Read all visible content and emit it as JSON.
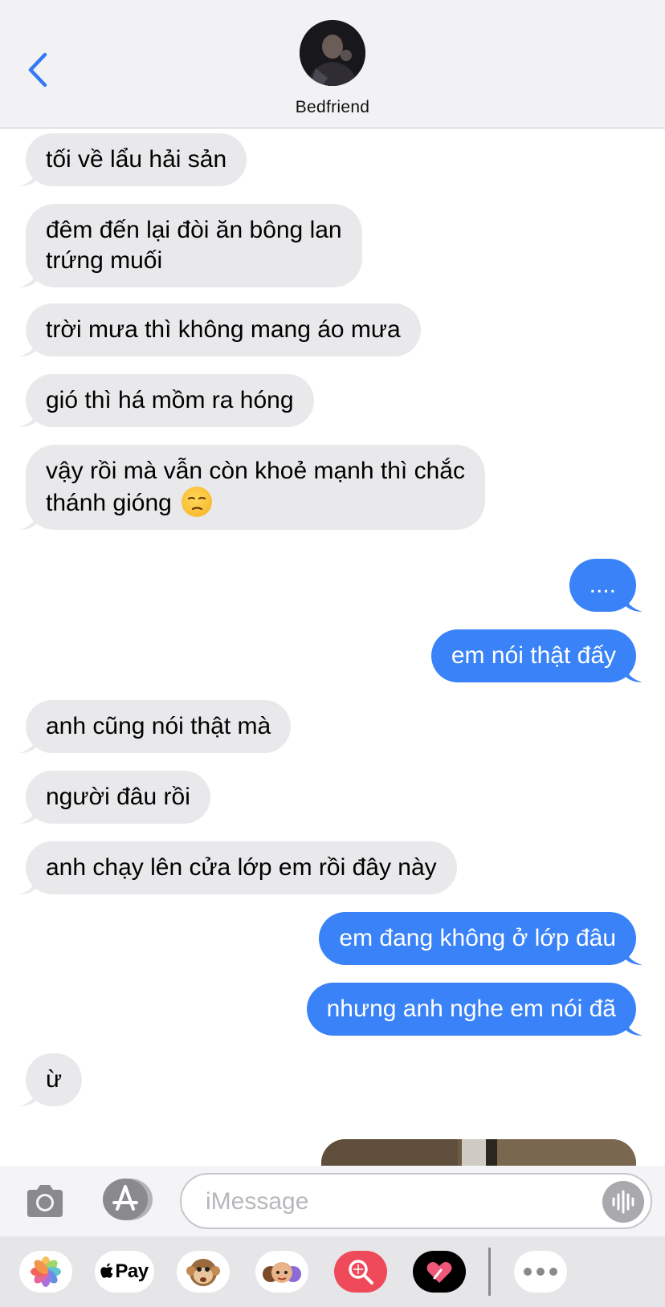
{
  "header": {
    "contact_name": "Bedfriend"
  },
  "messages": [
    {
      "side": "in",
      "lines": [
        "tối về lẩu hải sản"
      ]
    },
    {
      "side": "in",
      "lines": [
        "đêm đến lại đòi ăn bông lan",
        "trứng muối"
      ]
    },
    {
      "side": "in",
      "lines": [
        "trời mưa thì không mang áo mưa"
      ]
    },
    {
      "side": "in",
      "lines": [
        "gió thì há mồm ra hóng"
      ]
    },
    {
      "side": "in",
      "lines": [
        "vậy rồi mà vẫn còn khoẻ mạnh thì chắc",
        "thánh gióng"
      ],
      "emoji": "unamused-face-emoji"
    },
    {
      "side": "out",
      "lines": [
        "...."
      ]
    },
    {
      "side": "out",
      "lines": [
        "em nói thật đấy"
      ]
    },
    {
      "side": "in",
      "lines": [
        "anh cũng nói thật mà"
      ]
    },
    {
      "side": "in",
      "lines": [
        "người đâu rồi"
      ]
    },
    {
      "side": "in",
      "lines": [
        "anh chạy lên cửa lớp em rồi đây này"
      ]
    },
    {
      "side": "out",
      "lines": [
        "em đang không ở lớp đâu"
      ]
    },
    {
      "side": "out",
      "lines": [
        "nhưng anh nghe em nói đã"
      ]
    },
    {
      "side": "in",
      "lines": [
        "ừ"
      ]
    }
  ],
  "input": {
    "placeholder": "iMessage"
  },
  "app_drawer": {
    "items": [
      "photos-icon",
      "apple-pay",
      "animoji-icon",
      "memoji-icon",
      "image-search-icon",
      "digital-touch-icon",
      "more-icon"
    ],
    "pay_label": "Pay"
  },
  "colors": {
    "incoming_bubble": "#e9e9eb",
    "outgoing_bubble": "#3a82f7",
    "accent": "#3478f6"
  }
}
